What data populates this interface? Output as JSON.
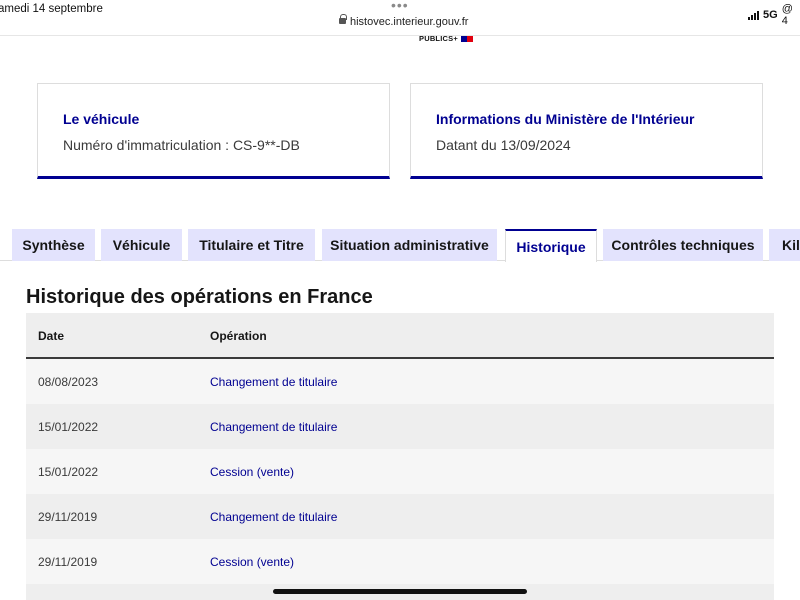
{
  "statusbar": {
    "time": "amedi 14 septembre",
    "dots": "•••",
    "url": "histovec.interieur.gouv.fr",
    "network": "5G",
    "extra": "@ 4"
  },
  "header": {
    "publics_label": "PUBLICS+"
  },
  "cards": [
    {
      "title": "Le véhicule",
      "text": "Numéro d'immatriculation : CS-9**-DB"
    },
    {
      "title": "Informations du Ministère de l'Intérieur",
      "text": "Datant du 13/09/2024"
    }
  ],
  "tabs": [
    {
      "label": "Synthèse",
      "active": false
    },
    {
      "label": "Véhicule",
      "active": false
    },
    {
      "label": "Titulaire et Titre",
      "active": false
    },
    {
      "label": "Situation administrative",
      "active": false
    },
    {
      "label": "Historique",
      "active": true
    },
    {
      "label": "Contrôles techniques",
      "active": false
    },
    {
      "label": "Kil",
      "active": false
    }
  ],
  "main": {
    "title": "Historique des opérations en France",
    "table": {
      "headers": [
        "Date",
        "Opération"
      ],
      "rows": [
        {
          "date": "08/08/2023",
          "operation": "Changement de titulaire"
        },
        {
          "date": "15/01/2022",
          "operation": "Changement de titulaire"
        },
        {
          "date": "15/01/2022",
          "operation": "Cession (vente)"
        },
        {
          "date": "29/11/2019",
          "operation": "Changement de titulaire"
        },
        {
          "date": "29/11/2019",
          "operation": "Cession (vente)"
        },
        {
          "date": "",
          "operation": ""
        }
      ]
    }
  },
  "colors": {
    "accent": "#000091",
    "tab_bg": "#e3e3fd",
    "row_light": "#f6f6f6",
    "row_dark": "#eeeeee"
  }
}
